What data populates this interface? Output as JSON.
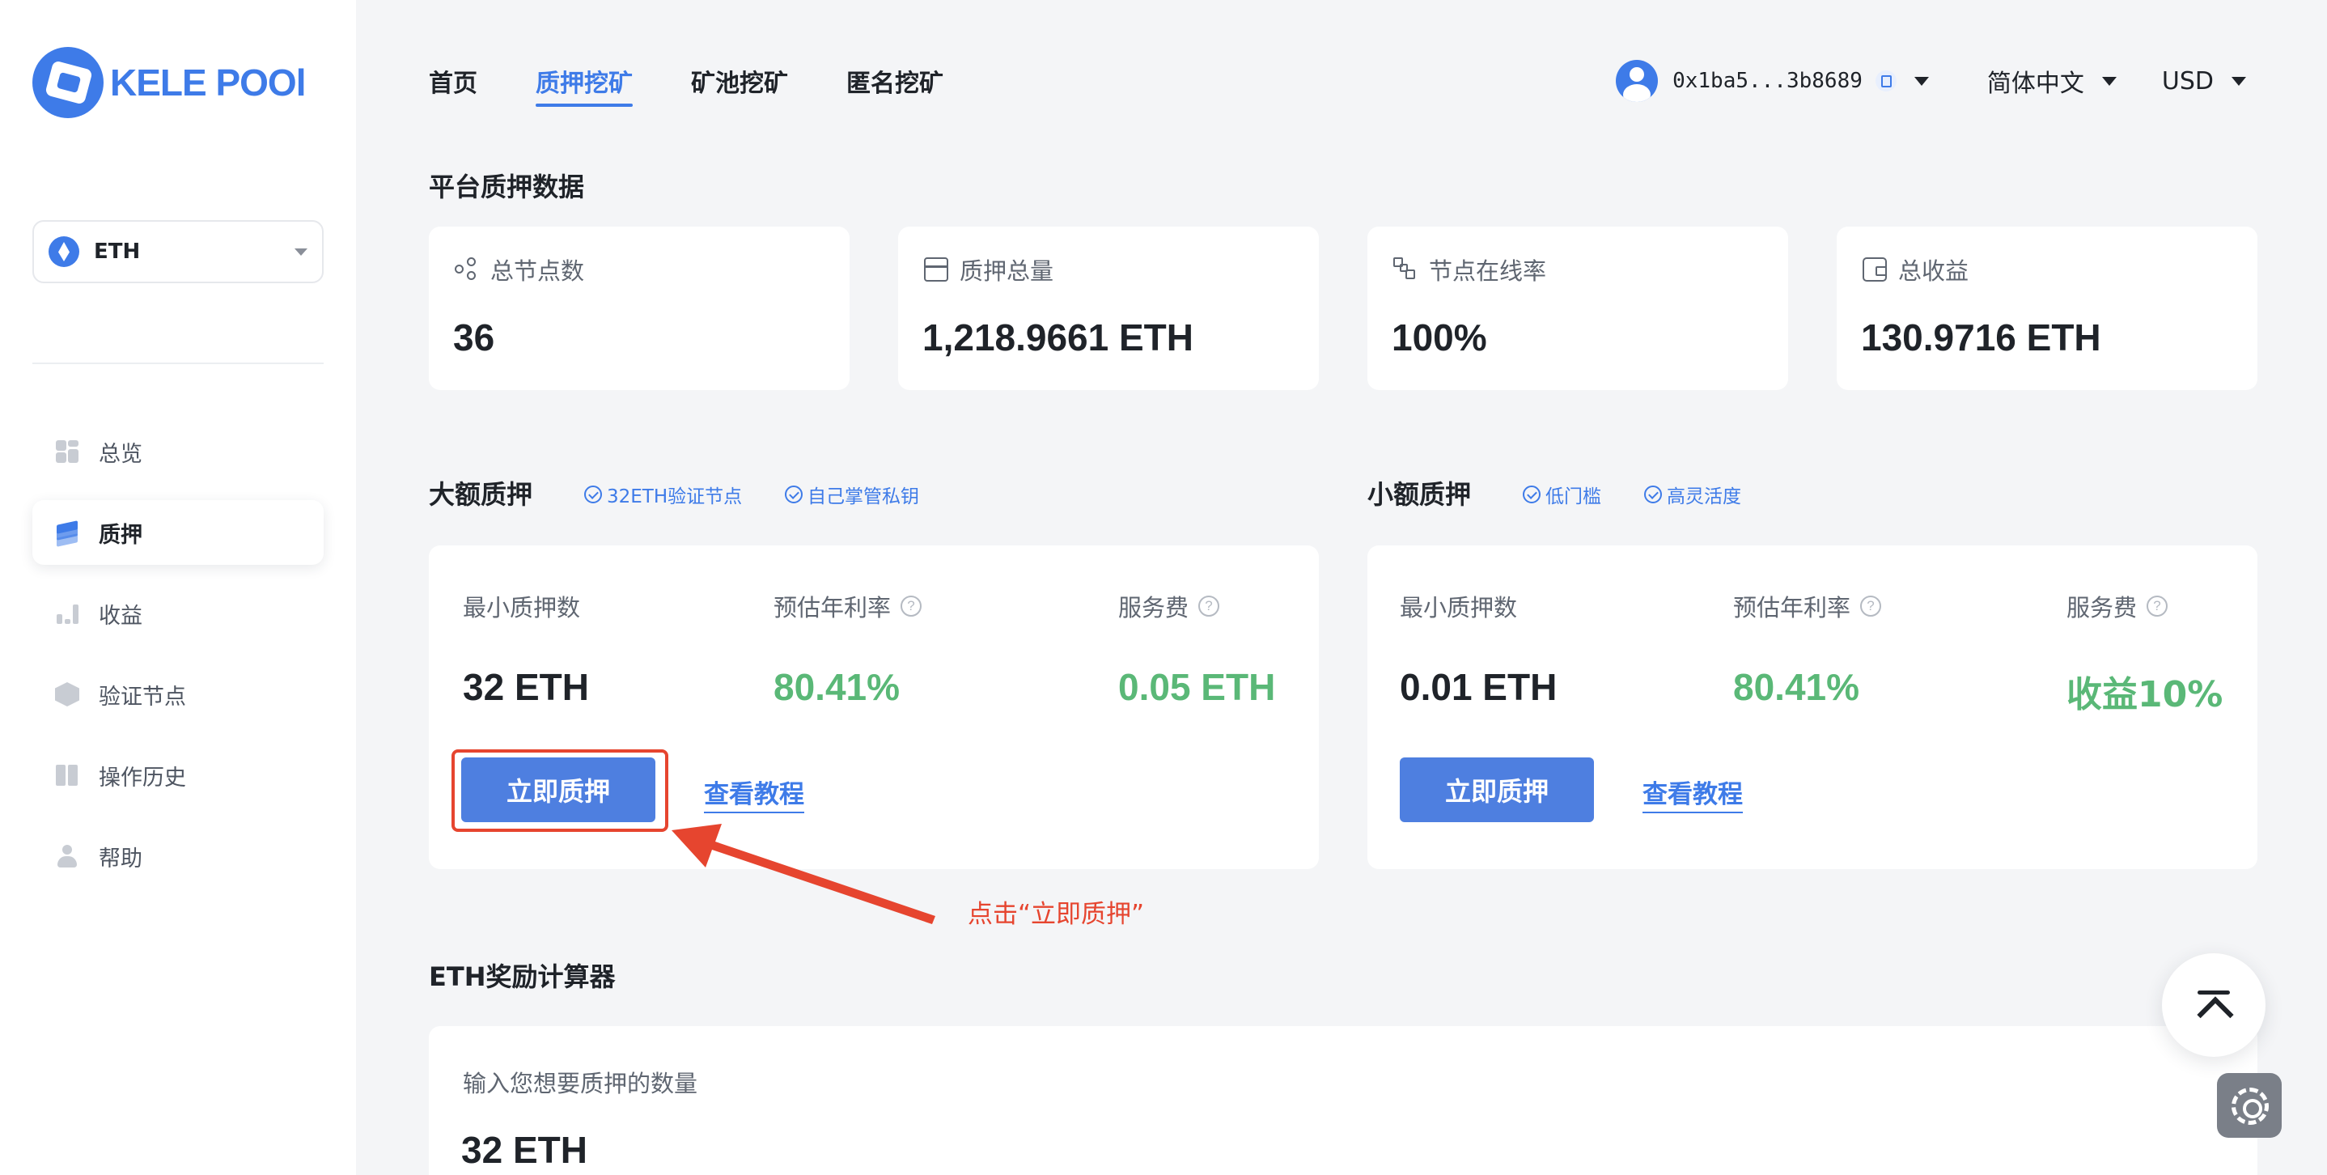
{
  "brand": {
    "logo_text": "KELE POOl"
  },
  "sidebar": {
    "coin": {
      "label": "ETH"
    },
    "items": [
      {
        "label": "总览",
        "icon": "grid-icon"
      },
      {
        "label": "质押",
        "icon": "layers-icon",
        "active": true
      },
      {
        "label": "收益",
        "icon": "bar-chart-icon"
      },
      {
        "label": "验证节点",
        "icon": "cube-icon"
      },
      {
        "label": "操作历史",
        "icon": "book-icon"
      },
      {
        "label": "帮助",
        "icon": "user-icon"
      }
    ]
  },
  "topnav": {
    "tabs": [
      {
        "label": "首页"
      },
      {
        "label": "质押挖矿",
        "active": true
      },
      {
        "label": "矿池挖矿"
      },
      {
        "label": "匿名挖矿"
      }
    ],
    "wallet_address": "0x1ba5...3b8689",
    "language": "简体中文",
    "currency": "USD"
  },
  "platform": {
    "title": "平台质押数据",
    "stats": [
      {
        "label": "总节点数",
        "value": "36",
        "icon": "nodes-icon"
      },
      {
        "label": "质押总量",
        "value": "1,218.9661 ETH",
        "icon": "box-icon"
      },
      {
        "label": "节点在线率",
        "value": "100%",
        "icon": "online-icon"
      },
      {
        "label": "总收益",
        "value": "130.9716 ETH",
        "icon": "wallet-icon"
      }
    ]
  },
  "large_pledge": {
    "title": "大额质押",
    "tags": [
      "32ETH验证节点",
      "自己掌管私钥"
    ],
    "min_label": "最小质押数",
    "min_value": "32 ETH",
    "apr_label": "预估年利率",
    "apr_value": "80.41%",
    "fee_label": "服务费",
    "fee_value": "0.05 ETH",
    "button": "立即质押",
    "link": "查看教程"
  },
  "small_pledge": {
    "title": "小额质押",
    "tags": [
      "低门槛",
      "高灵活度"
    ],
    "min_label": "最小质押数",
    "min_value": "0.01 ETH",
    "apr_label": "预估年利率",
    "apr_value": "80.41%",
    "fee_label": "服务费",
    "fee_value": "收益10%",
    "button": "立即质押",
    "link": "查看教程"
  },
  "annotation": {
    "text": "点击“立即质押”",
    "color": "#e6452f"
  },
  "calculator": {
    "title": "ETH奖励计算器",
    "input_label": "输入您想要质押的数量",
    "input_value": "32 ETH"
  },
  "colors": {
    "accent": "#3e7be8",
    "green": "#5ab877",
    "annotation": "#e6452f"
  }
}
